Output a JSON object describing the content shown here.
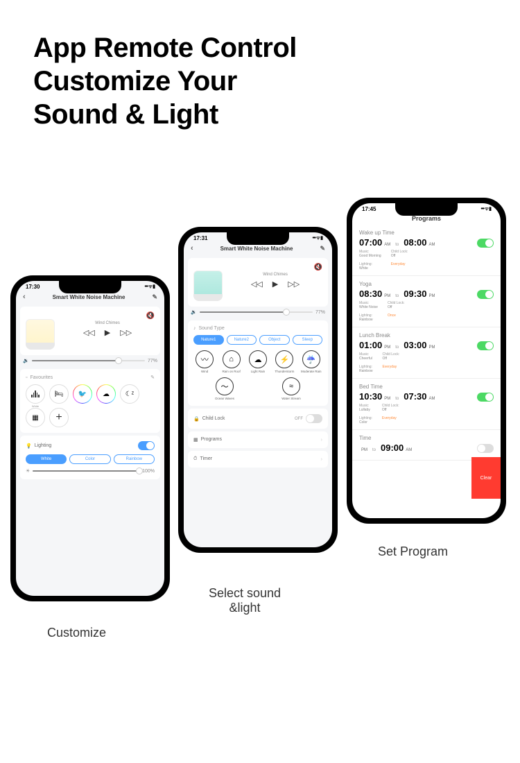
{
  "heading": {
    "l1": "App Remote Control",
    "l2": "Customize Your",
    "l3": "Sound & Light"
  },
  "captions": {
    "c1": "Customize",
    "c2": "Select sound &light",
    "c3": "Set Program"
  },
  "p1": {
    "time": "17:30",
    "title": "Smart White Noise Machine",
    "track": "Wind Chimes",
    "vol": "77%",
    "fav_header": "Favourites",
    "favs": [
      {
        "lbl": "White"
      },
      {
        "lbl": ""
      },
      {
        "lbl": ""
      },
      {
        "lbl": ""
      },
      {
        "lbl": ""
      },
      {
        "lbl": ""
      }
    ],
    "lighting": "Lighting",
    "pills": [
      "White",
      "Color",
      "Rainbow"
    ],
    "brightness": "100%"
  },
  "p2": {
    "time": "17:31",
    "title": "Smart White Noise Machine",
    "track": "Wind Chimes",
    "vol": "77%",
    "sound_type": "Sound Type",
    "tabs": [
      "Nature1",
      "Nature2",
      "Object",
      "Sleep"
    ],
    "sounds": [
      "Wind",
      "Rain on Roof",
      "Light Rain",
      "Thunderstorm",
      "Moderate Rain",
      "Ocean Waves",
      "Water Stream"
    ],
    "childlock": "Child Lock",
    "childlock_val": "OFF",
    "programs": "Programs",
    "timer": "Timer"
  },
  "p3": {
    "time": "17:45",
    "title": "Programs",
    "items": [
      {
        "name": "Wake up Time",
        "t1": "07:00",
        "a1": "AM",
        "t2": "08:00",
        "a2": "AM",
        "music": "Good Morning",
        "light": "White",
        "lock": "Off",
        "rep": "Everyday",
        "on": true
      },
      {
        "name": "Yoga",
        "t1": "08:30",
        "a1": "PM",
        "t2": "09:30",
        "a2": "PM",
        "music": "White Noise",
        "light": "Rainbow",
        "lock": "Off",
        "rep": "Once",
        "on": true
      },
      {
        "name": "Lunch Break",
        "t1": "01:00",
        "a1": "PM",
        "t2": "03:00",
        "a2": "PM",
        "music": "Cheerful",
        "light": "Rainbow",
        "lock": "Off",
        "rep": "Everyday",
        "on": true
      },
      {
        "name": "Bed Time",
        "t1": "10:30",
        "a1": "PM",
        "t2": "07:30",
        "a2": "AM",
        "music": "Lullaby",
        "light": "Color",
        "lock": "Off",
        "rep": "Everyday",
        "on": true
      },
      {
        "name": "Time",
        "t1": "",
        "a1": "PM",
        "t2": "09:00",
        "a2": "AM",
        "music": "",
        "light": "",
        "lock": "",
        "rep": "",
        "on": false
      }
    ],
    "labels": {
      "music": "Music:",
      "light": "Lighting:",
      "lock": "Child Lock:",
      "to": "to"
    },
    "clear": "Clear"
  }
}
